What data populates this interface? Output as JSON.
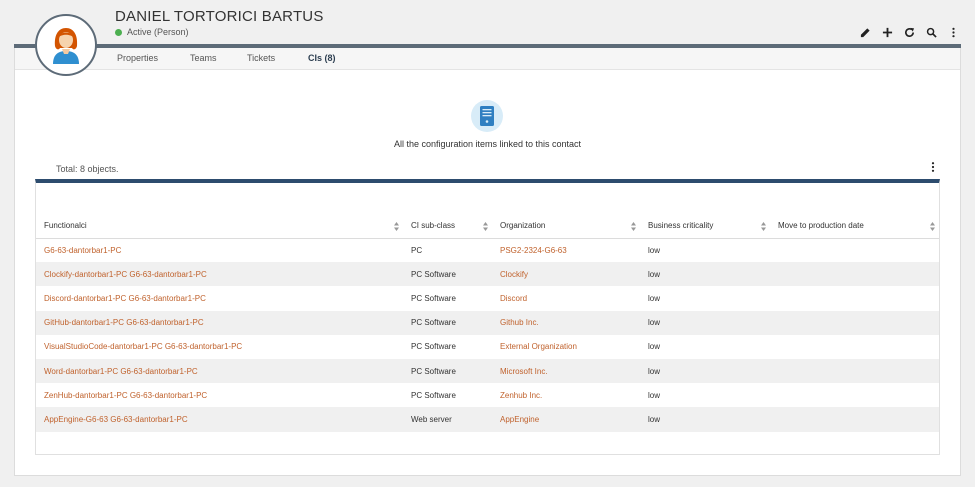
{
  "person": {
    "name": "DANIEL TORTORICI BARTUS",
    "status": "Active (Person)",
    "status_color": "#4caf50"
  },
  "toolbar": {
    "actions": [
      "edit-icon",
      "add-icon",
      "refresh-icon",
      "search-icon",
      "more-vertical-icon"
    ]
  },
  "tabs": [
    {
      "label": "Properties"
    },
    {
      "label": "Teams"
    },
    {
      "label": "Tickets"
    },
    {
      "label": "CIs (8)"
    }
  ],
  "ci_section": {
    "description": "All the configuration items linked to this contact",
    "total": "Total: 8 objects."
  },
  "table": {
    "columns": [
      "Functionalci",
      "CI sub-class",
      "Organization",
      "Business criticality",
      "Move to production date"
    ],
    "rows": [
      {
        "functionalci": "G6-63-dantorbar1-PC",
        "subclass": "PC",
        "organization": "PSG2-2324-G6-63",
        "criticality": "low",
        "production_date": ""
      },
      {
        "functionalci": "Clockify-dantorbar1-PC G6-63-dantorbar1-PC",
        "subclass": "PC Software",
        "organization": "Clockify",
        "criticality": "low",
        "production_date": ""
      },
      {
        "functionalci": "Discord-dantorbar1-PC G6-63-dantorbar1-PC",
        "subclass": "PC Software",
        "organization": "Discord",
        "criticality": "low",
        "production_date": ""
      },
      {
        "functionalci": "GitHub-dantorbar1-PC G6-63-dantorbar1-PC",
        "subclass": "PC Software",
        "organization": "Github Inc.",
        "criticality": "low",
        "production_date": ""
      },
      {
        "functionalci": "VisualStudioCode-dantorbar1-PC G6-63-dantorbar1-PC",
        "subclass": "PC Software",
        "organization": "External Organization",
        "criticality": "low",
        "production_date": ""
      },
      {
        "functionalci": "Word-dantorbar1-PC G6-63-dantorbar1-PC",
        "subclass": "PC Software",
        "organization": "Microsoft Inc.",
        "criticality": "low",
        "production_date": ""
      },
      {
        "functionalci": "ZenHub-dantorbar1-PC G6-63-dantorbar1-PC",
        "subclass": "PC Software",
        "organization": "Zenhub Inc.",
        "criticality": "low",
        "production_date": ""
      },
      {
        "functionalci": "AppEngine-G6-63 G6-63-dantorbar1-PC",
        "subclass": "Web server",
        "organization": "AppEngine",
        "criticality": "low",
        "production_date": ""
      }
    ]
  },
  "colors": {
    "link": "#c0622d",
    "header_bar": "#5d6b78",
    "table_top_border": "#2d4c6e",
    "ci_icon": "#2f7fc1"
  }
}
